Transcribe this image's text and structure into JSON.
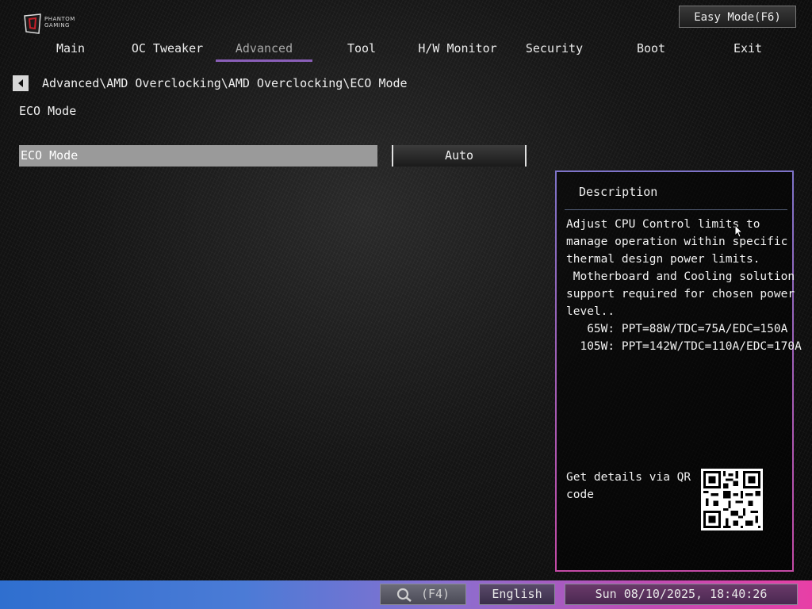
{
  "brand": {
    "name_line1": "PHANTOM",
    "name_line2": "GAMING"
  },
  "header": {
    "easy_mode_label": "Easy Mode(F6)"
  },
  "tabs": [
    {
      "label": "Main"
    },
    {
      "label": "OC Tweaker"
    },
    {
      "label": "Advanced",
      "active": true
    },
    {
      "label": "Tool"
    },
    {
      "label": "H/W Monitor"
    },
    {
      "label": "Security"
    },
    {
      "label": "Boot"
    },
    {
      "label": "Exit"
    }
  ],
  "breadcrumb": "Advanced\\AMD Overclocking\\AMD Overclocking\\ECO Mode",
  "page_title": "ECO Mode",
  "setting": {
    "label": "ECO Mode",
    "value": "Auto"
  },
  "description": {
    "title": "Description",
    "text": "Adjust CPU Control limits to\nmanage operation within specific\nthermal design power limits.\n Motherboard and Cooling solution\nsupport required for chosen power\nlevel..\n   65W: PPT=88W/TDC=75A/EDC=150A\n  105W: PPT=142W/TDC=110A/EDC=170A",
    "qr_label": "Get details via QR code"
  },
  "footer": {
    "search_label": "(F4)",
    "language": "English",
    "datetime": "Sun 08/10/2025, 18:40:26"
  },
  "colors": {
    "accent_tab": "#8a5fb8",
    "footer_start": "#2f6fcf",
    "footer_end": "#e83fa6"
  },
  "icons": {
    "back": "left-arrow-icon",
    "search": "search-icon",
    "logo": "phantom-gaming-logo",
    "qr": "qr-code"
  }
}
